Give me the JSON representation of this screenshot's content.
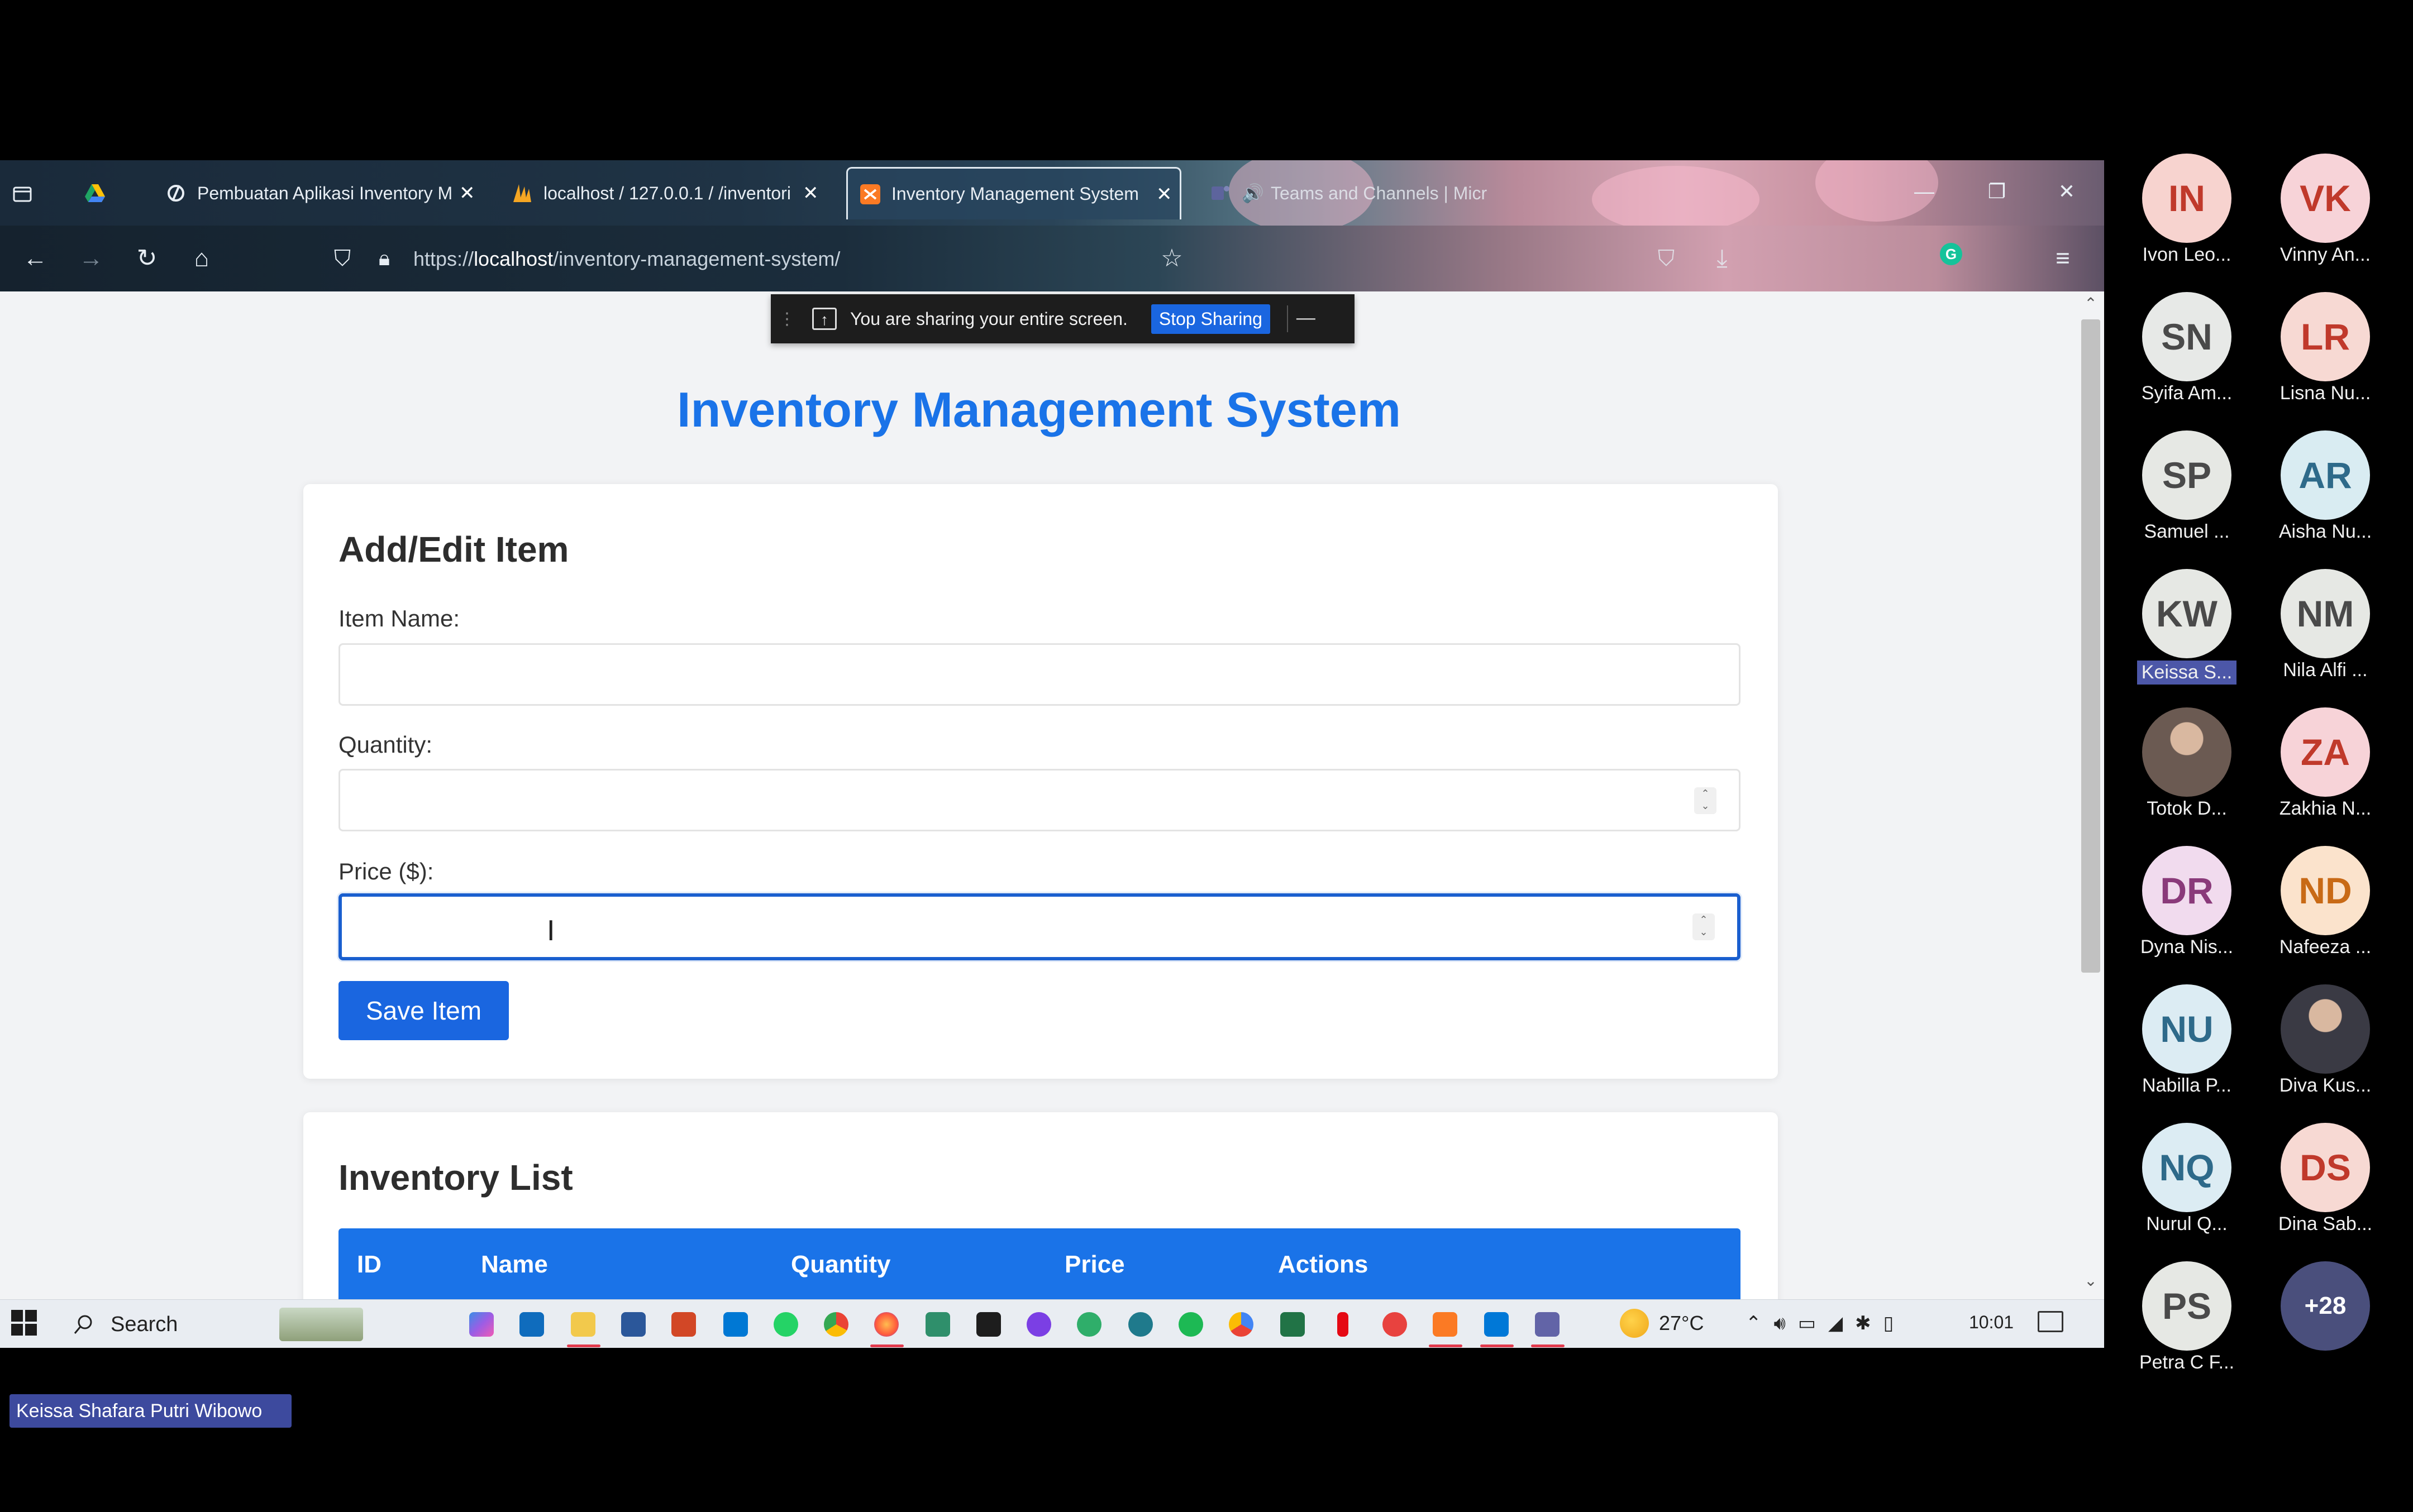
{
  "browser": {
    "tabs": [
      {
        "label": "Pembuatan Aplikasi Inventory M",
        "icon": "loop-icon",
        "active": false
      },
      {
        "label": "localhost / 127.0.0.1 / /inventori",
        "icon": "phpmyadmin-icon",
        "active": false
      },
      {
        "label": "Inventory Management System",
        "icon": "xampp-icon",
        "active": true
      },
      {
        "label": "Teams and Channels | Micr",
        "icon": "teams-icon",
        "active": false
      }
    ],
    "url_prefix": "https://",
    "url_host": "localhost",
    "url_path": "/inventory-management-system/"
  },
  "share_banner": {
    "message": "You are sharing your entire screen.",
    "stop_label": "Stop Sharing",
    "minimize_label": "—"
  },
  "app": {
    "title": "Inventory Management System",
    "form": {
      "heading": "Add/Edit Item",
      "item_name_label": "Item Name:",
      "item_name_value": "",
      "quantity_label": "Quantity:",
      "quantity_value": "",
      "price_label": "Price ($):",
      "price_value": "",
      "save_label": "Save Item"
    },
    "list": {
      "heading": "Inventory List",
      "columns": [
        "ID",
        "Name",
        "Quantity",
        "Price",
        "Actions"
      ]
    }
  },
  "taskbar": {
    "search_label": "Search",
    "temperature": "27°C",
    "clock": "10:01"
  },
  "presenter": {
    "name": "Keissa Shafara Putri Wibowo"
  },
  "participants": [
    {
      "initials": "IN",
      "name": "Ivon Leo...",
      "color": "#f7d3cf",
      "text_color": "#c0392b"
    },
    {
      "initials": "VK",
      "name": "Vinny An...",
      "color": "#f7d3d8",
      "text_color": "#c0392b"
    },
    {
      "initials": "SN",
      "name": "Syifa Am...",
      "color": "#e7e9e7",
      "text_color": "#4a4a4a"
    },
    {
      "initials": "LR",
      "name": "Lisna Nu...",
      "color": "#f7d9d3",
      "text_color": "#c0392b"
    },
    {
      "initials": "SP",
      "name": "Samuel ...",
      "color": "#e6e8e4",
      "text_color": "#4a4a4a"
    },
    {
      "initials": "AR",
      "name": "Aisha Nu...",
      "color": "#d9ecf2",
      "text_color": "#2e6a8a"
    },
    {
      "initials": "KW",
      "name": "Keissa S...",
      "color": "#e6e8e4",
      "text_color": "#4a4a4a",
      "highlight": true
    },
    {
      "initials": "NM",
      "name": "Nila Alfi ...",
      "color": "#e6e8e4",
      "text_color": "#4a4a4a"
    },
    {
      "initials": "",
      "name": "Totok D...",
      "color": "#6b5a52",
      "text_color": "#fff",
      "photo": true
    },
    {
      "initials": "ZA",
      "name": "Zakhia N...",
      "color": "#f7d3d8",
      "text_color": "#c0392b"
    },
    {
      "initials": "DR",
      "name": "Dyna Nis...",
      "color": "#f1dbee",
      "text_color": "#8a3a7a"
    },
    {
      "initials": "ND",
      "name": "Nafeeza ...",
      "color": "#fbe3cc",
      "text_color": "#c86a16"
    },
    {
      "initials": "NU",
      "name": "Nabilla P...",
      "color": "#dcecf3",
      "text_color": "#2e6a8a"
    },
    {
      "initials": "",
      "name": "Diva Kus...",
      "color": "#3a3a44",
      "text_color": "#fff",
      "photo": true
    },
    {
      "initials": "NQ",
      "name": "Nurul Q...",
      "color": "#dcecf3",
      "text_color": "#2e6a8a"
    },
    {
      "initials": "DS",
      "name": "Dina Sab...",
      "color": "#f7d9d3",
      "text_color": "#c0392b"
    },
    {
      "initials": "PS",
      "name": "Petra C F...",
      "color": "#e6e8e4",
      "text_color": "#4a4a4a"
    },
    {
      "initials": "+28",
      "name": "",
      "color": "#4a4f7c",
      "text_color": "#fff",
      "overflow": true
    }
  ]
}
